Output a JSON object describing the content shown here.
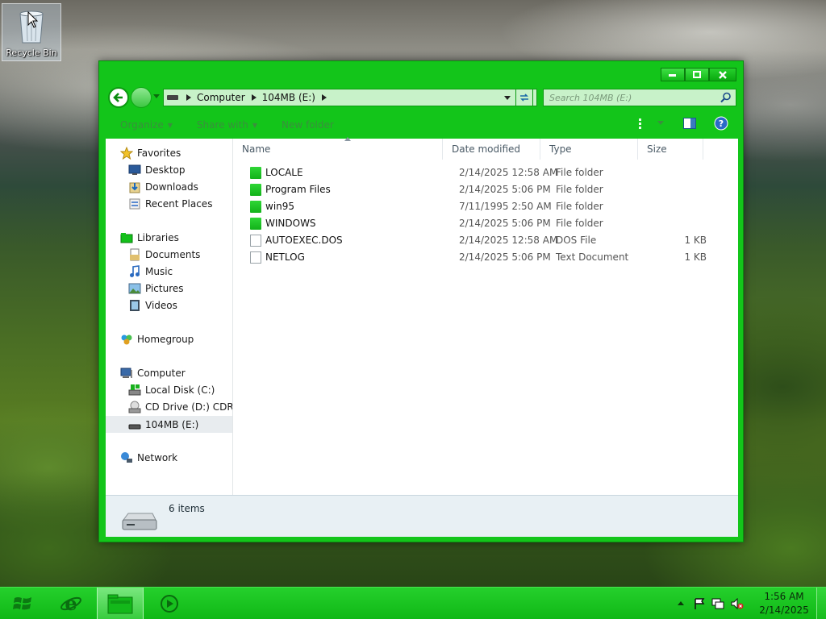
{
  "desktop": {
    "recycle_bin_label": "Recycle Bin"
  },
  "window": {
    "address": {
      "crumbs": [
        "Computer",
        "104MB (E:)"
      ]
    },
    "search_placeholder": "Search 104MB (E:)",
    "toolbar": {
      "organize": "Organize",
      "share_with": "Share with",
      "new_folder": "New folder"
    },
    "nav": {
      "favorites": "Favorites",
      "desktop": "Desktop",
      "downloads": "Downloads",
      "recent_places": "Recent Places",
      "libraries": "Libraries",
      "documents": "Documents",
      "music": "Music",
      "pictures": "Pictures",
      "videos": "Videos",
      "homegroup": "Homegroup",
      "computer": "Computer",
      "local_disk": "Local Disk (C:)",
      "cd_drive": "CD Drive (D:) CDROM",
      "drive_e": "104MB (E:)",
      "network": "Network"
    },
    "columns": {
      "name": "Name",
      "date_modified": "Date modified",
      "type": "Type",
      "size": "Size"
    },
    "files": [
      {
        "name": "LOCALE",
        "date": "2/14/2025 12:58 AM",
        "type": "File folder",
        "size": "",
        "kind": "folder"
      },
      {
        "name": "Program Files",
        "date": "2/14/2025 5:06 PM",
        "type": "File folder",
        "size": "",
        "kind": "folder"
      },
      {
        "name": "win95",
        "date": "7/11/1995 2:50 AM",
        "type": "File folder",
        "size": "",
        "kind": "folder"
      },
      {
        "name": "WINDOWS",
        "date": "2/14/2025 5:06 PM",
        "type": "File folder",
        "size": "",
        "kind": "folder"
      },
      {
        "name": "AUTOEXEC.DOS",
        "date": "2/14/2025 12:58 AM",
        "type": "DOS File",
        "size": "1 KB",
        "kind": "file"
      },
      {
        "name": "NETLOG",
        "date": "2/14/2025 5:06 PM",
        "type": "Text Document",
        "size": "1 KB",
        "kind": "file"
      }
    ],
    "status_text": "6 items"
  },
  "taskbar": {
    "time": "1:56 AM",
    "date": "2/14/2025"
  },
  "colors": {
    "accent": "#13c51a",
    "taskbar": "#1cc422",
    "address_bg": "#c8f2c9"
  }
}
